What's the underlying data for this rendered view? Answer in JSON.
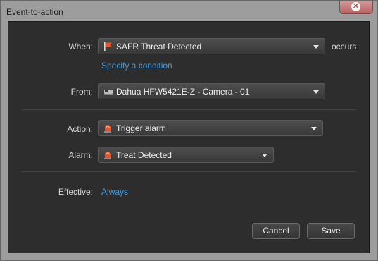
{
  "window": {
    "title": "Event-to-action",
    "close_icon": "close-icon"
  },
  "when": {
    "label": "When:",
    "value": "SAFR Threat Detected",
    "icon": "event-flag-icon",
    "suffix": "occurs",
    "condition_link": "Specify a condition"
  },
  "from": {
    "label": "From:",
    "value": "Dahua HFW5421E-Z - Camera - 01",
    "icon": "camera-icon"
  },
  "action": {
    "label": "Action:",
    "value": "Trigger alarm",
    "icon": "alarm-light-icon"
  },
  "alarm": {
    "label": "Alarm:",
    "value": "Treat Detected",
    "icon": "alarm-light-icon"
  },
  "effective": {
    "label": "Effective:",
    "value": "Always"
  },
  "buttons": {
    "cancel": "Cancel",
    "save": "Save"
  },
  "colors": {
    "accent_link": "#3d9ee8",
    "panel": "#2d2d2d",
    "frame": "#9d9d9d",
    "close": "#b86262"
  }
}
